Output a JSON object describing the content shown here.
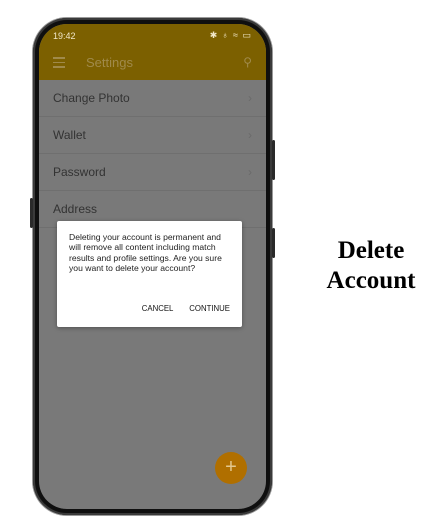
{
  "status_bar": {
    "time": "19:42",
    "icons": "✱ ♁ ≈ ▭"
  },
  "appbar": {
    "title": "Settings",
    "menu_icon": "menu-icon",
    "search_icon": "search-icon"
  },
  "settings_items": [
    {
      "label": "Change Photo"
    },
    {
      "label": "Wallet"
    },
    {
      "label": "Password"
    },
    {
      "label": "Address"
    }
  ],
  "dialog": {
    "message": "Deleting your account is permanent and will remove all content including match results and profile settings. Are you sure you want to delete your account?",
    "cancel_label": "CANCEL",
    "continue_label": "CONTINUE"
  },
  "fab": {
    "symbol": "+"
  },
  "caption": {
    "line1": "Delete",
    "line2": "Account"
  },
  "colors": {
    "appbar": "#7c6000",
    "fab": "#b06f00",
    "screen_dim": "#797979"
  }
}
